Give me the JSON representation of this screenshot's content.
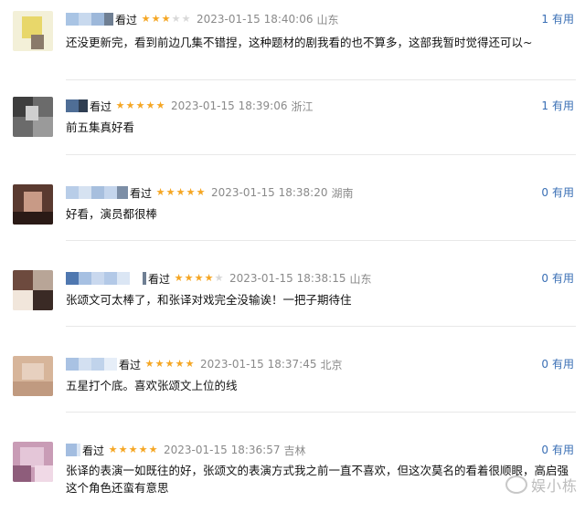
{
  "reviews": [
    {
      "watched": "看过",
      "rating": 3,
      "time": "2023-01-15 18:40:06",
      "location": "山东",
      "useful_count": "1",
      "useful_label": "有用",
      "text": "还没更新完，看到前边几集不错捏，这种题材的剧我看的也不算多，这部我暂时觉得还可以~"
    },
    {
      "watched": "看过",
      "rating": 5,
      "time": "2023-01-15 18:39:06",
      "location": "浙江",
      "useful_count": "1",
      "useful_label": "有用",
      "text": "前五集真好看"
    },
    {
      "watched": "看过",
      "rating": 5,
      "time": "2023-01-15 18:38:20",
      "location": "湖南",
      "useful_count": "0",
      "useful_label": "有用",
      "text": "好看，演员都很棒"
    },
    {
      "watched": "看过",
      "rating": 4,
      "time": "2023-01-15 18:38:15",
      "location": "山东",
      "useful_count": "0",
      "useful_label": "有用",
      "text": "张颂文可太棒了，和张译对戏完全没输诶！一把子期待住"
    },
    {
      "watched": "看过",
      "rating": 5,
      "time": "2023-01-15 18:37:45",
      "location": "北京",
      "useful_count": "0",
      "useful_label": "有用",
      "text": "五星打个底。喜欢张颂文上位的线"
    },
    {
      "watched": "看过",
      "rating": 5,
      "time": "2023-01-15 18:36:57",
      "location": "吉林",
      "useful_count": "0",
      "useful_label": "有用",
      "text": "张译的表演一如既往的好，张颂文的表演方式我之前一直不喜欢，但这次莫名的看着很顺眼，高启强这个角色还蛮有意思"
    }
  ],
  "watermark": "娱小栋",
  "colors": {
    "star": "#f5a623",
    "useful": "#3a6fb5",
    "meta": "#8a8a8a"
  }
}
